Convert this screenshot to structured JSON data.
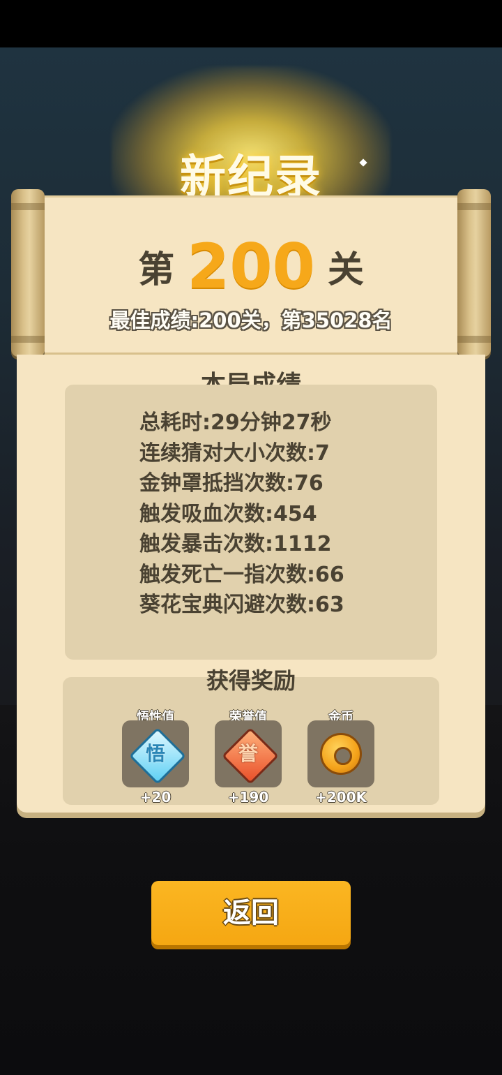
{
  "header": {
    "title": "新纪录"
  },
  "level": {
    "prefix": "第",
    "number": "200",
    "suffix": "关"
  },
  "best_result": "最佳成绩:200关，第35028名",
  "stats": {
    "title": "本局成绩",
    "items": [
      "总耗时:29分钟27秒",
      "连续猜对大小次数:7",
      "金钟罩抵挡次数:76",
      "触发吸血次数:454",
      "触发暴击次数:1112",
      "触发死亡一指次数:66",
      "葵花宝典闪避次数:63"
    ]
  },
  "rewards": {
    "title": "获得奖励",
    "items": [
      {
        "label": "悟性值",
        "icon": "wuxing-diamond-icon",
        "glyph": "悟",
        "amount": "+20"
      },
      {
        "label": "荣誉值",
        "icon": "honor-diamond-icon",
        "glyph": "誉",
        "amount": "+190"
      },
      {
        "label": "金币",
        "icon": "gold-coin-icon",
        "amount": "+200K"
      }
    ]
  },
  "back_button": {
    "label": "返回"
  },
  "colors": {
    "accent": "#f6a81a",
    "button": "#fbb622",
    "paper": "#f6e5c2",
    "text": "#4a4232"
  }
}
